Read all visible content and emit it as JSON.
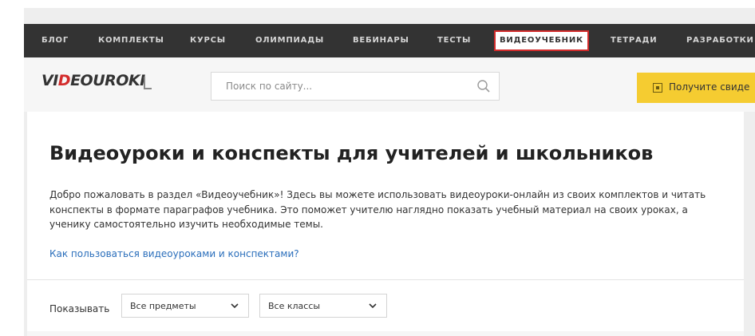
{
  "nav": {
    "items": [
      {
        "label": "БЛОГ"
      },
      {
        "label": "КОМПЛЕКТЫ"
      },
      {
        "label": "КУРСЫ"
      },
      {
        "label": "ОЛИМПИАДЫ"
      },
      {
        "label": "ВЕБИНАРЫ"
      },
      {
        "label": "ТЕСТЫ"
      },
      {
        "label": "ВИДЕОУЧЕБНИК",
        "active": true
      },
      {
        "label": "ТЕТРАДИ"
      },
      {
        "label": "РАЗРАБОТКИ"
      }
    ]
  },
  "header": {
    "logo_prefix": "VI",
    "logo_accent": "D",
    "logo_rest": "EOUROKI",
    "search_placeholder": "Поиск по сайту...",
    "cta_label": "Получите свиде"
  },
  "main": {
    "title": "Видеоуроки и конспекты для учителей и школьников",
    "intro": "Добро пожаловать в раздел «Видеоучебник»! Здесь вы можете использовать видеоуроки-онлайн из своих комплектов и читать конспекты в формате параграфов учебника. Это поможет учителю наглядно показать учебный материал на своих уроках, а ученику самостоятельно изучить необходимые темы.",
    "help_link": "Как пользоваться видеоуроками и конспектами?"
  },
  "filters": {
    "show_label": "Показывать",
    "subject_value": "Все предметы",
    "class_value": "Все классы"
  },
  "colors": {
    "nav_bg": "#333333",
    "accent_red": "#d32b2b",
    "cta_yellow": "#f5cc31",
    "link_blue": "#2a6ebb"
  }
}
